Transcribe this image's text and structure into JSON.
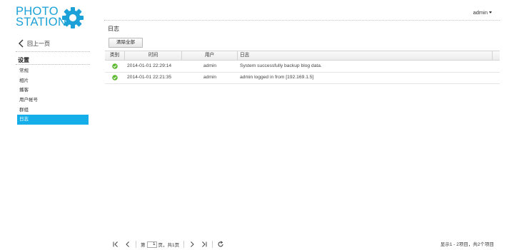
{
  "logo": {
    "line1": "PHOTO",
    "line2": "STATION"
  },
  "sidebar": {
    "back_label": "回上一页",
    "settings_heading": "设置",
    "items": [
      {
        "label": "常规"
      },
      {
        "label": "相片"
      },
      {
        "label": "播客"
      },
      {
        "label": "用户帐号"
      },
      {
        "label": "群组"
      },
      {
        "label": "日志",
        "active": true
      }
    ]
  },
  "header": {
    "user": "admin"
  },
  "main": {
    "title": "日志",
    "clear_all_label": "清除全部",
    "columns": [
      "类别",
      "时间",
      "用户",
      "日志"
    ],
    "rows": [
      {
        "type_icon": "success-check-icon",
        "time": "2014-01-01 22:29:14",
        "user": "admin",
        "log": "System successfully backup blog data."
      },
      {
        "type_icon": "success-check-icon",
        "time": "2014-01-01 22:21:35",
        "user": "admin",
        "log": "admin logged in from [192.169.1.5]"
      }
    ]
  },
  "pager": {
    "page_prefix": "第",
    "page_value": "1",
    "page_suffix": "页，共1页",
    "info": "显示1 - 2项目，共2个项目"
  },
  "colors": {
    "accent": "#16aee8",
    "logo": "#1ba1d8",
    "success": "#5cb930"
  }
}
